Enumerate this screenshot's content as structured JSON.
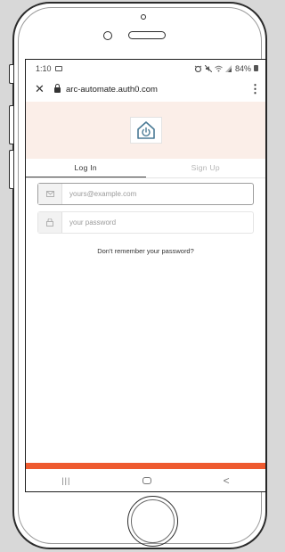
{
  "status_bar": {
    "time": "1:10",
    "battery": "84%"
  },
  "browser": {
    "url": "arc-automate.auth0.com",
    "close_glyph": "✕",
    "menu_glyph": "⋮"
  },
  "tabs": [
    {
      "label": "Log In",
      "active": true
    },
    {
      "label": "Sign Up",
      "active": false
    }
  ],
  "form": {
    "email_placeholder": "yours@example.com",
    "password_placeholder": "your password",
    "forgot_link": "Don't remember your password?"
  },
  "nav": {
    "recent_glyph": "|||",
    "back_glyph": "<"
  },
  "colors": {
    "accent": "#ee5a2f",
    "hero_bg": "#fbeee8",
    "logo_blue": "#4a7a95"
  }
}
